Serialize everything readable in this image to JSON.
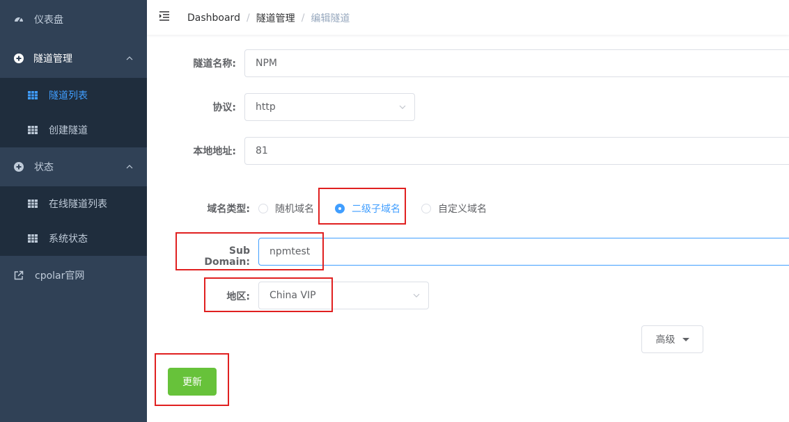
{
  "sidebar": {
    "dashboard": "仪表盘",
    "tunnel_mgmt": "隧道管理",
    "tunnel_list": "隧道列表",
    "create_tunnel": "创建隧道",
    "status": "状态",
    "online_tunnels": "在线隧道列表",
    "system_status": "系统状态",
    "official_site": "cpolar官网"
  },
  "breadcrumb": {
    "home": "Dashboard",
    "section": "隧道管理",
    "current": "编辑隧道",
    "separator": "/"
  },
  "form": {
    "name_label": "隧道名称:",
    "name_value": "NPM",
    "protocol_label": "协议:",
    "protocol_value": "http",
    "local_label": "本地地址:",
    "local_value": "81",
    "domain_type_label": "域名类型:",
    "domain_options": [
      "随机域名",
      "二级子域名",
      "自定义域名"
    ],
    "domain_selected": "二级子域名",
    "subdomain_label": "Sub Domain:",
    "subdomain_value": "npmtest",
    "region_label": "地区:",
    "region_value": "China VIP",
    "advanced_label": "高级",
    "update_label": "更新"
  },
  "colors": {
    "sidebar_bg": "#304156",
    "submenu_bg": "#1f2d3d",
    "accent": "#409eff",
    "success": "#67c23a",
    "highlight": "#e02020"
  }
}
